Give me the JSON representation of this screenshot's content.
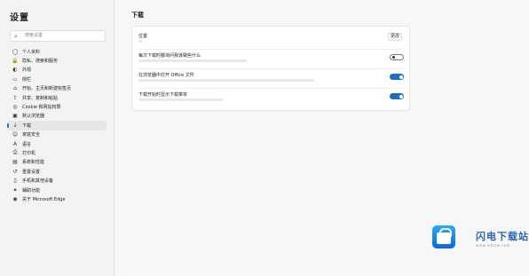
{
  "sidebar": {
    "title": "设置",
    "search_placeholder": "搜索设置",
    "items": [
      {
        "icon": "profile-icon",
        "glyph": "◯",
        "label": "个人资料"
      },
      {
        "icon": "lock-icon",
        "glyph": "🔒",
        "label": "隐私、搜索和服务"
      },
      {
        "icon": "appearance-icon",
        "glyph": "◐",
        "label": "外观"
      },
      {
        "icon": "sidebar-icon",
        "glyph": "▭",
        "label": "侧栏"
      },
      {
        "icon": "start-icon",
        "glyph": "⌂",
        "label": "开始、主页和新建标签页"
      },
      {
        "icon": "share-icon",
        "glyph": "⇪",
        "label": "共享、复制和粘贴"
      },
      {
        "icon": "cookie-icon",
        "glyph": "◎",
        "label": "Cookie 和网站权限"
      },
      {
        "icon": "default-browser-icon",
        "glyph": "▣",
        "label": "默认浏览器"
      },
      {
        "icon": "download-icon",
        "glyph": "↓",
        "label": "下载"
      },
      {
        "icon": "family-icon",
        "glyph": "☺",
        "label": "家庭安全"
      },
      {
        "icon": "language-icon",
        "glyph": "A",
        "label": "语言"
      },
      {
        "icon": "printer-icon",
        "glyph": "⎙",
        "label": "打印机"
      },
      {
        "icon": "system-icon",
        "glyph": "▤",
        "label": "系统和性能"
      },
      {
        "icon": "reset-icon",
        "glyph": "↺",
        "label": "重置设置"
      },
      {
        "icon": "phone-icon",
        "glyph": "▯",
        "label": "手机和其他设备"
      },
      {
        "icon": "accessibility-icon",
        "glyph": "✦",
        "label": "辅助功能"
      },
      {
        "icon": "edge-icon",
        "glyph": "◉",
        "label": "关于 Microsoft Edge"
      }
    ],
    "active_index": 8
  },
  "main": {
    "title": "下载",
    "change_label": "更改",
    "rows": [
      {
        "label": "位置",
        "sub": "",
        "control": "button",
        "sub_width": 4
      },
      {
        "label": "每次下载时都询问我该做些什么",
        "sub": "",
        "control": "toggle",
        "on": false,
        "sub_width": 122
      },
      {
        "label": "在浏览器中打开 Office 文件",
        "sub": "",
        "control": "toggle",
        "on": true,
        "sub_width": 198
      },
      {
        "label": "下载开始时显示下载菜单",
        "sub": "",
        "control": "toggle",
        "on": true,
        "sub_width": 96
      }
    ]
  },
  "watermark": {
    "text": "闪电下载站",
    "url": "www.sdxzw.com"
  },
  "colors": {
    "accent": "#1a6fc4",
    "sidebar_bg": "#f3f3f3",
    "page_bg": "#f7f7f7"
  }
}
